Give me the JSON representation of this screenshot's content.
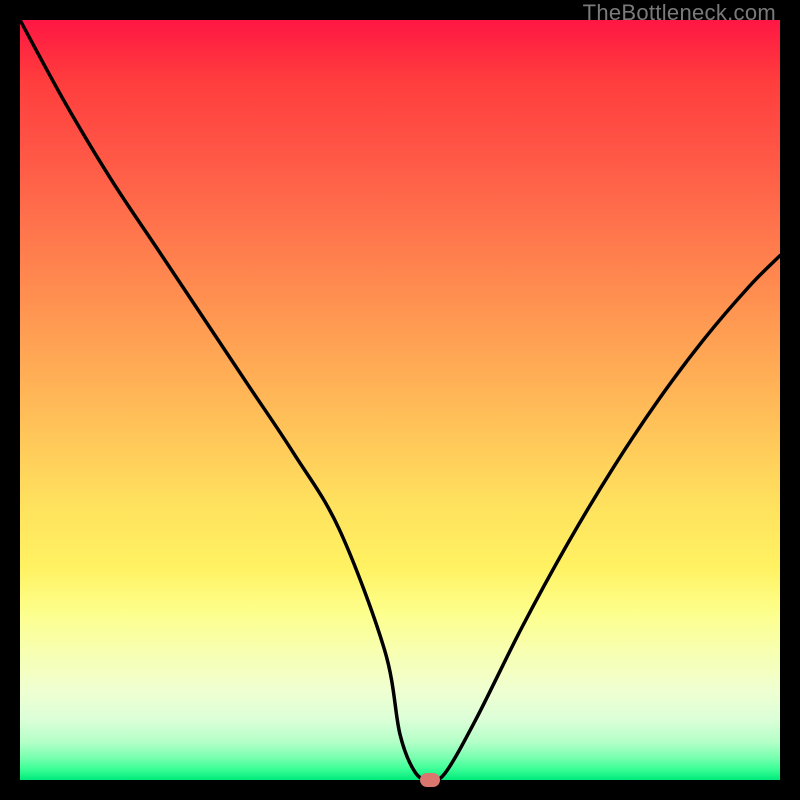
{
  "watermark": "TheBottleneck.com",
  "colors": {
    "frame": "#000000",
    "curve": "#000000",
    "marker": "#d9776f"
  },
  "chart_data": {
    "type": "line",
    "title": "",
    "xlabel": "",
    "ylabel": "",
    "xlim": [
      0,
      100
    ],
    "ylim": [
      0,
      100
    ],
    "grid": false,
    "legend": "none",
    "series": [
      {
        "name": "bottleneck-curve",
        "x": [
          0,
          6,
          12,
          18,
          24,
          30,
          36,
          42,
          48,
          50,
          52,
          54,
          56,
          60,
          66,
          72,
          78,
          84,
          90,
          96,
          100
        ],
        "y": [
          100,
          89,
          79,
          70,
          61,
          52,
          43,
          33,
          17,
          6,
          1,
          0,
          1,
          8,
          20,
          31,
          41,
          50,
          58,
          65,
          69
        ]
      }
    ],
    "annotations": [
      {
        "name": "minimum-marker",
        "x": 54,
        "y": 0
      }
    ],
    "background_gradient_stops": [
      {
        "pos": 0.0,
        "color": "#ff1744"
      },
      {
        "pos": 0.5,
        "color": "#ffca5a"
      },
      {
        "pos": 0.8,
        "color": "#fdff8c"
      },
      {
        "pos": 1.0,
        "color": "#00ea7a"
      }
    ]
  }
}
